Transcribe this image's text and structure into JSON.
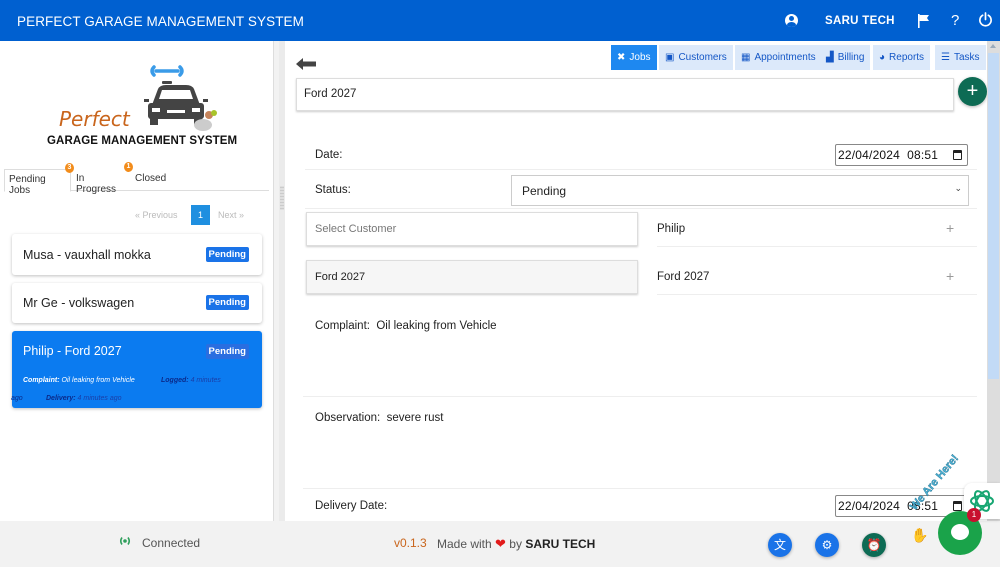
{
  "header": {
    "title": "PERFECT GARAGE MANAGEMENT SYSTEM",
    "user_name": "SARU TECH",
    "help_label": "?"
  },
  "logo": {
    "script_text": "Perfect",
    "subtitle": "GARAGE MANAGEMENT SYSTEM"
  },
  "job_tabs": [
    {
      "label": "Pending Jobs",
      "badge": "3",
      "active": true
    },
    {
      "label": "In Progress",
      "badge": "1",
      "active": false
    },
    {
      "label": "Closed",
      "badge": "",
      "active": false
    }
  ],
  "pagination": {
    "previous_label": "«  Previous",
    "current_page": "1",
    "next_label": "Next  »"
  },
  "jobs": [
    {
      "title": "Musa - vauxhall mokka",
      "status": "Pending"
    },
    {
      "title": "Mr Ge - volkswagen",
      "status": "Pending"
    },
    {
      "title": "Philip - Ford 2027",
      "status": "Pending",
      "complaint_label": "Complaint:",
      "complaint": "Oil leaking from Vehicle",
      "logged_label": "Logged:",
      "logged": "4 minutes",
      "logged_wrap": "ago",
      "delivery_label": "Delivery:",
      "delivery": "4 minutes ago"
    }
  ],
  "nav": [
    {
      "label": "Jobs",
      "icon": "✖",
      "active": true
    },
    {
      "label": "Customers",
      "icon": "▣",
      "active": false
    },
    {
      "label": "Appointments",
      "icon": "▦",
      "active": false
    },
    {
      "label": "Billing",
      "icon": "▟",
      "active": false
    },
    {
      "label": "Reports",
      "icon": "◕",
      "active": false
    },
    {
      "label": "Tasks",
      "icon": "☰",
      "active": false
    }
  ],
  "vehicle_search": {
    "value": "Ford 2027"
  },
  "form": {
    "date_label": "Date:",
    "date_value": "22/04/2024  08:51",
    "status_label": "Status:",
    "status_value": "Pending",
    "customer_placeholder": "Select  Customer",
    "customer_selected": "Philip",
    "vehicle_value": "Ford 2027",
    "vehicle_selected": "Ford 2027",
    "complaint_label": "Complaint:",
    "complaint_value": "Oil leaking from Vehicle",
    "observation_label": "Observation:",
    "observation_value": "severe rust",
    "delivery_label": "Delivery Date:",
    "delivery_value": "22/04/2024  08:51"
  },
  "footer": {
    "connection_status": "Connected",
    "version": "v0.1.3",
    "made_with": "Made with",
    "heart": "❤",
    "by": "by",
    "brand": "SARU TECH"
  },
  "chat": {
    "greeting": "We Are Here!",
    "unread": "1"
  },
  "colors": {
    "primary": "#0060d0",
    "active_card": "#0b7bf0",
    "badge_orange": "#f28c1b",
    "fab_green": "#0d6b54",
    "accent_orange": "#c9651c",
    "connected_green": "#2e9e5b"
  }
}
